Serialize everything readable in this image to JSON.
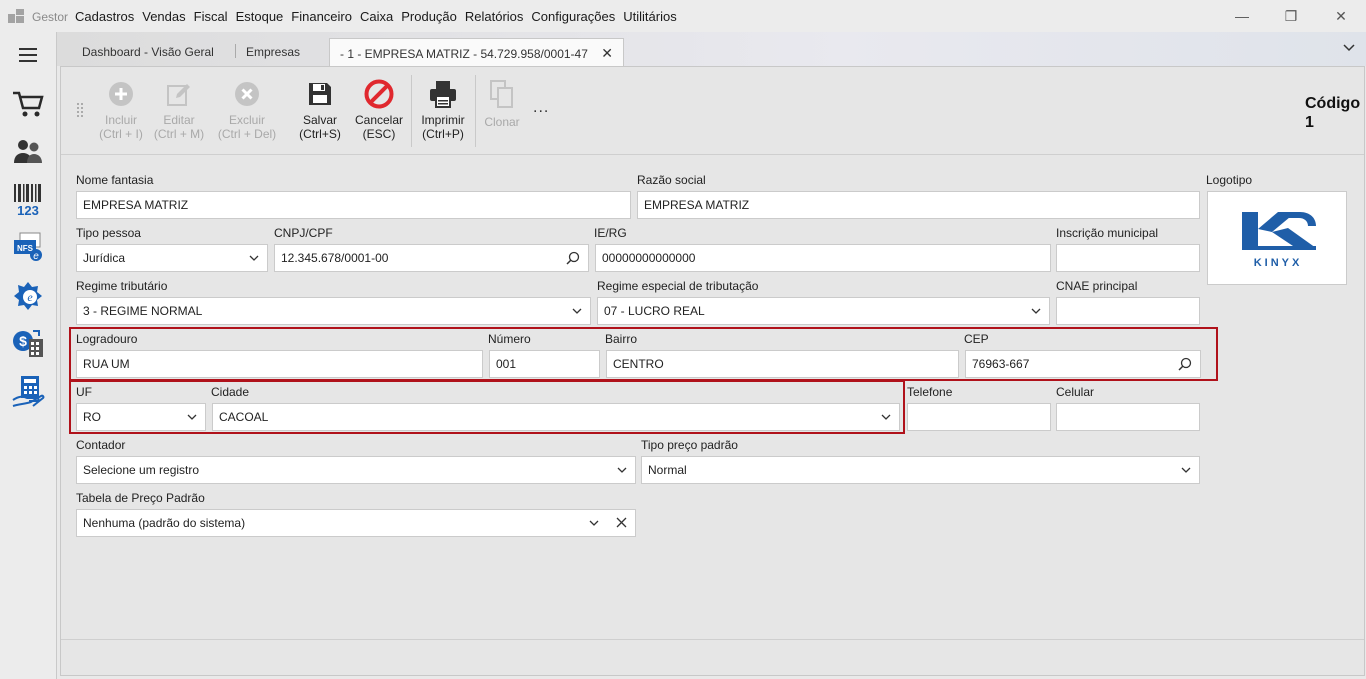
{
  "app": {
    "name": "Gestor"
  },
  "menu": [
    "Cadastros",
    "Vendas",
    "Fiscal",
    "Estoque",
    "Financeiro",
    "Caixa",
    "Produção",
    "Relatórios",
    "Configurações",
    "Utilitários"
  ],
  "window_controls": {
    "minimize": "—",
    "restore": "❐",
    "close": "✕"
  },
  "sidebar_icons": [
    "menu-icon",
    "cart-icon",
    "people-icon",
    "barcode-icon",
    "nfse-icon",
    "nfe-icon",
    "cash-register-icon",
    "calculator-icon"
  ],
  "sidebar_barcode_text": "123",
  "sidebar_nfs_text": "NFS",
  "tabs": [
    {
      "label": "Dashboard - Visão Geral"
    },
    {
      "label": "Empresas"
    },
    {
      "label": "- 1 - EMPRESA MATRIZ - 54.729.958/0001-47",
      "close": "✕"
    }
  ],
  "toolbar": {
    "incluir": {
      "label": "Incluir",
      "shortcut": "(Ctrl + I)"
    },
    "editar": {
      "label": "Editar",
      "shortcut": "(Ctrl + M)"
    },
    "excluir": {
      "label": "Excluir",
      "shortcut": "(Ctrl + Del)"
    },
    "salvar": {
      "label": "Salvar",
      "shortcut": "(Ctrl+S)"
    },
    "cancelar": {
      "label": "Cancelar",
      "shortcut": "(ESC)"
    },
    "imprimir": {
      "label": "Imprimir",
      "shortcut": "(Ctrl+P)"
    },
    "clonar": {
      "label": "Clonar"
    },
    "more": "..."
  },
  "codigo": {
    "label": "Código",
    "value": "1"
  },
  "form": {
    "nome_fantasia": {
      "label": "Nome fantasia",
      "value": "EMPRESA MATRIZ"
    },
    "razao_social": {
      "label": "Razão social",
      "value": "EMPRESA MATRIZ"
    },
    "logotipo": {
      "label": "Logotipo",
      "brand": "KINYX",
      "brand_color": "#1f5ea8"
    },
    "tipo_pessoa": {
      "label": "Tipo pessoa",
      "value": "Jurídica"
    },
    "cnpj": {
      "label": "CNPJ/CPF",
      "value": "12.345.678/0001-00"
    },
    "ie": {
      "label": "IE/RG",
      "value": "00000000000000"
    },
    "inscricao_municipal": {
      "label": "Inscrição municipal",
      "value": ""
    },
    "regime_tributario": {
      "label": "Regime tributário",
      "value": "3 - REGIME NORMAL"
    },
    "regime_especial": {
      "label": "Regime especial de tributação",
      "value": "07 - LUCRO REAL"
    },
    "cnae": {
      "label": "CNAE principal",
      "value": ""
    },
    "logradouro": {
      "label": "Logradouro",
      "value": "RUA UM"
    },
    "numero": {
      "label": "Número",
      "value": "001"
    },
    "bairro": {
      "label": "Bairro",
      "value": "CENTRO"
    },
    "cep": {
      "label": "CEP",
      "value": "76963-667"
    },
    "uf": {
      "label": "UF",
      "value": "RO"
    },
    "cidade": {
      "label": "Cidade",
      "value": "CACOAL"
    },
    "telefone": {
      "label": "Telefone",
      "value": ""
    },
    "celular": {
      "label": "Celular",
      "value": ""
    },
    "contador": {
      "label": "Contador",
      "value": "Selecione um registro"
    },
    "tipo_preco": {
      "label": "Tipo preço padrão",
      "value": "Normal"
    },
    "tabela_preco": {
      "label": "Tabela de Preço Padrão",
      "value": "Nenhuma (padrão do sistema)"
    }
  },
  "colors": {
    "highlight": "#b0121b",
    "cancel_red": "#e0282e",
    "brand_blue": "#1f5ea8",
    "sidebar_blue": "#1a62b8"
  }
}
